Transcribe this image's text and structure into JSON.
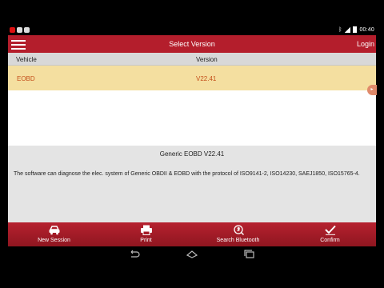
{
  "statusbar": {
    "time": "00:40",
    "network": "3G",
    "bluetooth_icon": "bluetooth-icon"
  },
  "header": {
    "title": "Select Version",
    "login": "Login"
  },
  "table": {
    "columns": [
      "Vehicle",
      "Version"
    ],
    "rows": [
      {
        "vehicle": "EOBD",
        "version": "V22.41",
        "selected": true
      }
    ]
  },
  "description": {
    "title": "Generic EOBD V22.41",
    "text": "The software can diagnose the elec. system of Generic OBDII & EOBD with the protocol of ISO9141-2, ISO14230, SAEJ1850, ISO15765-4."
  },
  "toolbar": {
    "items": [
      {
        "label": "New Session",
        "icon": "car-icon"
      },
      {
        "label": "Print",
        "icon": "printer-icon"
      },
      {
        "label": "Search Bluetooth",
        "icon": "bluetooth-search-icon"
      },
      {
        "label": "Confirm",
        "icon": "checkmark-icon"
      }
    ]
  },
  "colors": {
    "header": "#b41e2c",
    "selected_row": "#f4dfa0",
    "selected_text": "#c4501b"
  }
}
